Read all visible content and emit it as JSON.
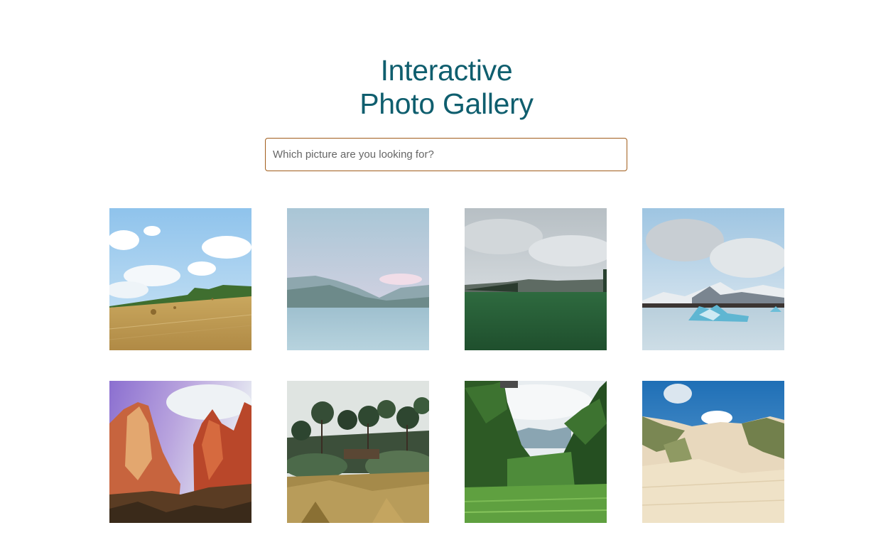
{
  "header": {
    "title_line1": "Interactive",
    "title_line2": "Photo Gallery"
  },
  "search": {
    "placeholder": "Which picture are you looking for?",
    "value": ""
  },
  "gallery": {
    "photos": [
      {
        "subject": "wheat field with hay bales under cloudy blue sky"
      },
      {
        "subject": "calm lake with misty mountains"
      },
      {
        "subject": "green meadow under overcast sky"
      },
      {
        "subject": "glacier lagoon with icebergs"
      },
      {
        "subject": "red rock canyon cliffs"
      },
      {
        "subject": "garden with tall pine trees"
      },
      {
        "subject": "green valley with lush vegetation"
      },
      {
        "subject": "sand dunes with grass under blue sky"
      }
    ]
  },
  "colors": {
    "title": "#0f5e6e",
    "search_border": "#a15d1b"
  }
}
